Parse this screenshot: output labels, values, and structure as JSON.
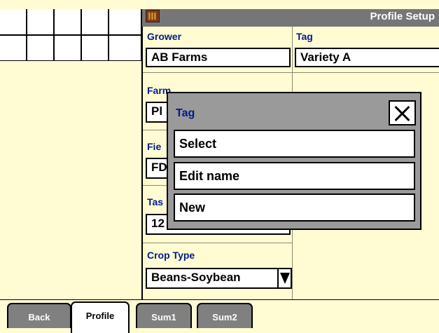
{
  "header": {
    "title": "Profile Setup",
    "icon": "profile-setup-icon"
  },
  "fields": {
    "grower": {
      "label": "Grower",
      "value": "AB Farms"
    },
    "tag": {
      "label": "Tag",
      "value": "Variety A"
    },
    "farm": {
      "label": "Farm",
      "value": "Pl"
    },
    "field": {
      "label": "Fie",
      "value": "FD"
    },
    "task": {
      "label": "Tas",
      "value": "12"
    },
    "crop_type": {
      "label": "Crop Type",
      "value": "Beans-Soybean"
    }
  },
  "modal": {
    "title": "Tag",
    "items": [
      "Select",
      "Edit name",
      "New"
    ]
  },
  "tabs": [
    {
      "label": "Back"
    },
    {
      "label": "Profile"
    },
    {
      "label": "Sum1"
    },
    {
      "label": "Sum2"
    }
  ],
  "colors": {
    "label_blue": "#001a8c",
    "background": "#fffcd4",
    "titlebar": "#767676"
  }
}
